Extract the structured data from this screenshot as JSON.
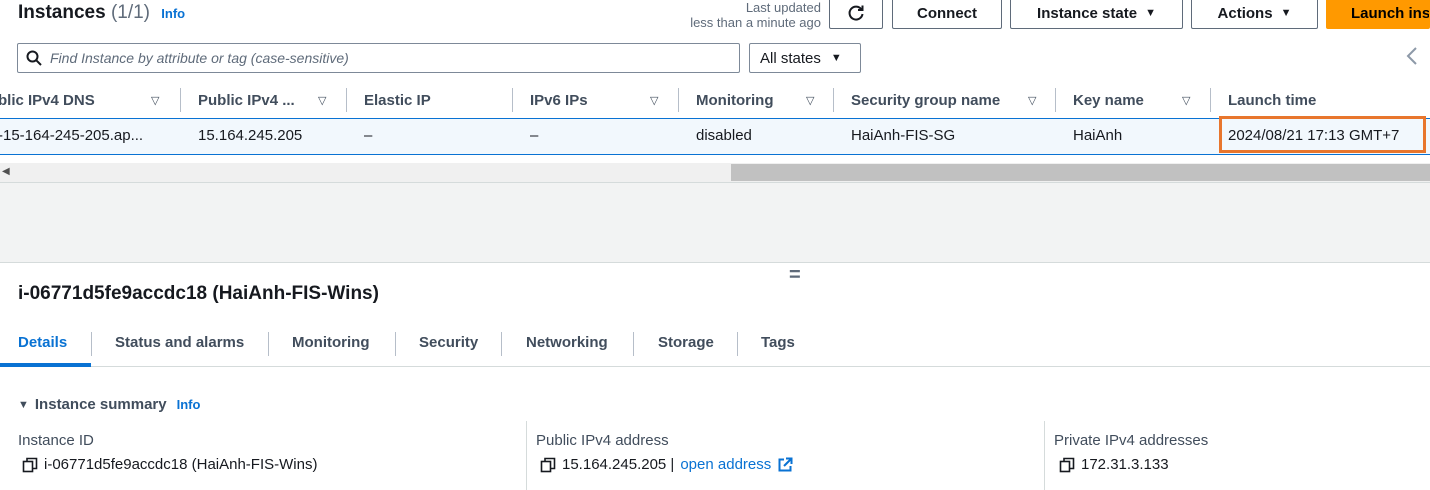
{
  "header": {
    "title": "Instances",
    "count": "(1/1)",
    "info": "Info",
    "last_updated_line1": "Last updated",
    "last_updated_line2": "less than a minute ago",
    "connect": "Connect",
    "instance_state": "Instance state",
    "actions": "Actions",
    "launch": "Launch ins"
  },
  "filter": {
    "search_placeholder": "Find Instance by attribute or tag (case-sensitive)",
    "states": "All states"
  },
  "table": {
    "columns": [
      "blic IPv4 DNS",
      "Public IPv4 ...",
      "Elastic IP",
      "IPv6 IPs",
      "Monitoring",
      "Security group name",
      "Key name",
      "Launch time"
    ],
    "row": {
      "dns": "-15-164-245-205.ap...",
      "ipv4": "15.164.245.205",
      "elastic_ip": "–",
      "ipv6": "–",
      "monitoring": "disabled",
      "security_group": "HaiAnh-FIS-SG",
      "key_name": "HaiAnh",
      "launch_time": "2024/08/21 17:13 GMT+7"
    }
  },
  "details": {
    "title": "i-06771d5fe9accdc18 (HaiAnh-FIS-Wins)",
    "tabs": [
      "Details",
      "Status and alarms",
      "Monitoring",
      "Security",
      "Networking",
      "Storage",
      "Tags"
    ],
    "section": "Instance summary",
    "section_info": "Info",
    "fields": {
      "instance_id_label": "Instance ID",
      "instance_id_value": "i-06771d5fe9accdc18 (HaiAnh-FIS-Wins)",
      "public_ipv4_label": "Public IPv4 address",
      "public_ipv4_value": "15.164.245.205 |",
      "open_address": "open address",
      "private_ipv4_label": "Private IPv4 addresses",
      "private_ipv4_value": "172.31.3.133"
    }
  },
  "colors": {
    "accent": "#0972d3",
    "primary_button": "#ff9900",
    "highlight_box": "#e8762d"
  },
  "icons": [
    "refresh-icon",
    "search-icon",
    "caret-down-icon",
    "chevron-left-icon",
    "copy-icon",
    "external-link-icon",
    "resize-handle-icon"
  ]
}
